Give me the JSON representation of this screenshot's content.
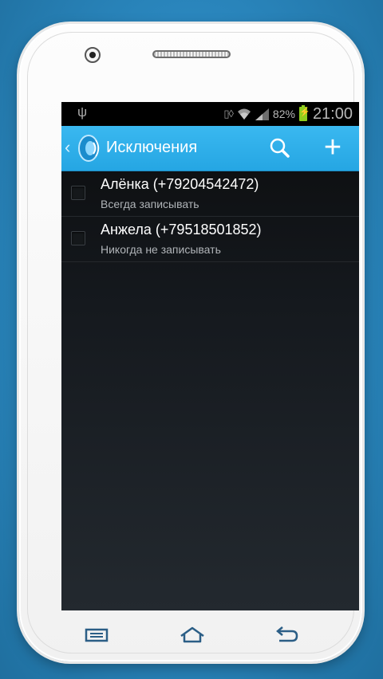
{
  "status_bar": {
    "battery_percent": "82%",
    "time": "21:00",
    "icons": [
      "usb-icon",
      "vibrate-icon",
      "wifi-icon",
      "cell-signal-icon",
      "battery-charging-icon"
    ]
  },
  "action_bar": {
    "title": "Исключения",
    "icons": [
      "back-chevron-icon",
      "app-logo-icon",
      "search-icon",
      "add-icon"
    ],
    "add_label": "+",
    "accent_color": "#2aa9e6"
  },
  "exceptions": [
    {
      "title": "Алёнка (+79204542472)",
      "subtitle": "Всегда записывать",
      "checked": false
    },
    {
      "title": "Анжела (+79518501852)",
      "subtitle": "Никогда не записывать",
      "checked": false
    }
  ],
  "nav_bar": {
    "icons": [
      "menu-icon",
      "home-icon",
      "back-icon"
    ]
  }
}
